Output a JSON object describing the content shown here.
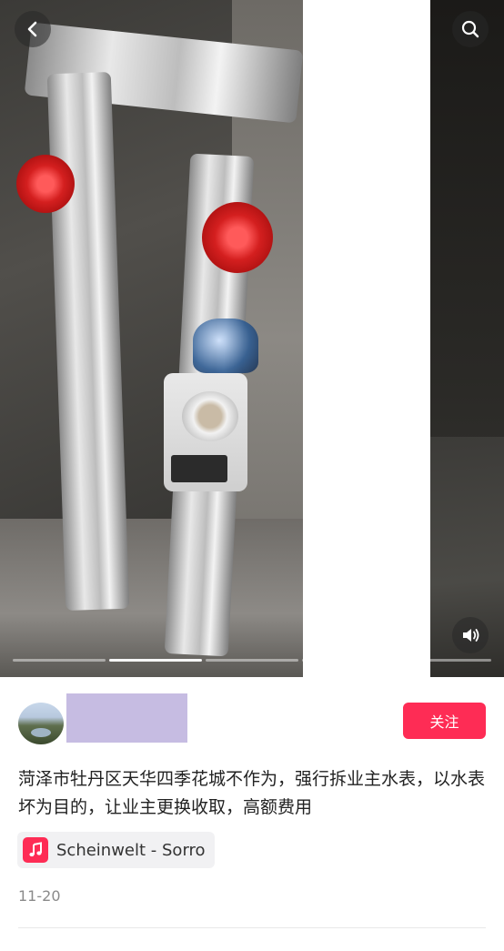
{
  "header": {
    "back_icon": "chevron-left-icon",
    "search_icon": "search-icon"
  },
  "media": {
    "volume_icon": "volume-icon",
    "carousel_progress": {
      "segments": 5,
      "active_index": 1
    }
  },
  "author": {
    "follow_label": "关注"
  },
  "post": {
    "description": "菏泽市牡丹区天华四季花城不作为，强行拆业主水表，以水表坏为目的，让业主更换收取，高额费用",
    "music_label": "Scheinwelt - Sorro",
    "date": "11-20"
  },
  "colors": {
    "accent": "#fe2c55",
    "redacted_block": "#c6bce2"
  }
}
